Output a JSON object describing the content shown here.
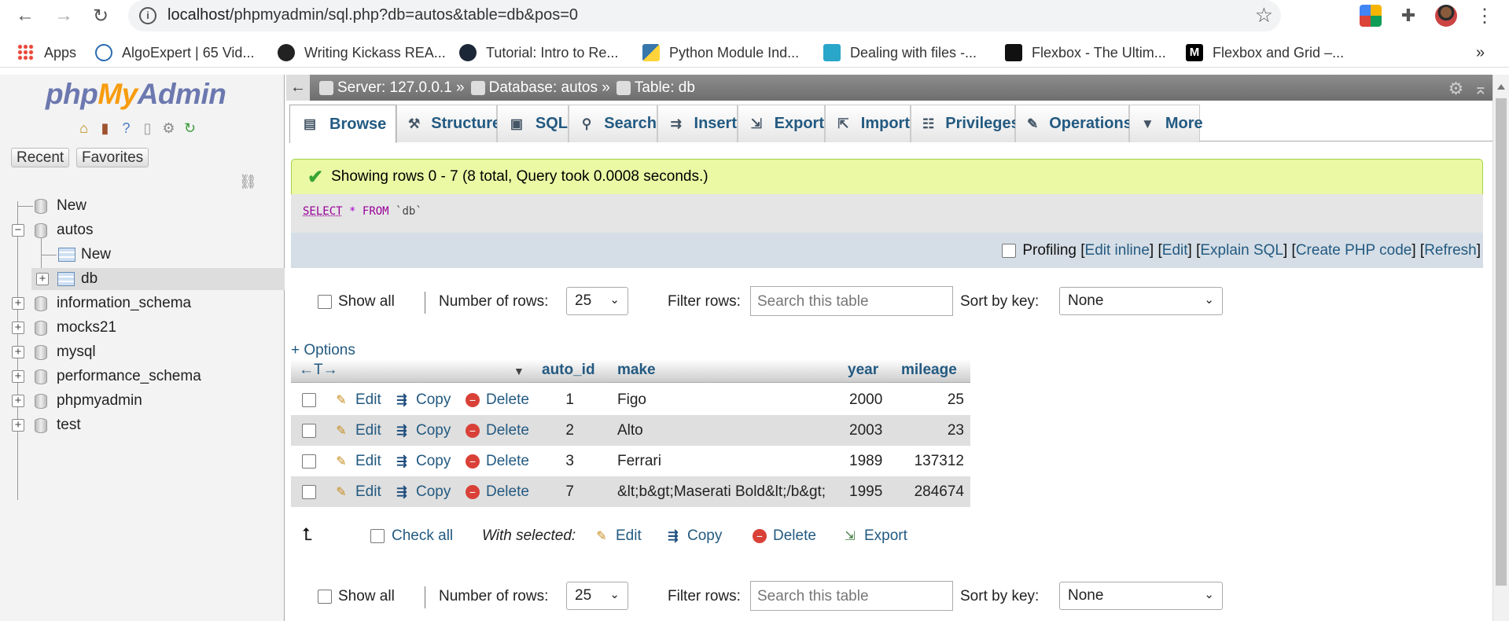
{
  "browser": {
    "url_host": "localhost",
    "url_path": "/phpmyadmin/sql.php?db=autos&table=db&pos=0",
    "bookmarks": [
      {
        "label": "Apps",
        "icon": "apps-grid-icon",
        "color": "#ea4335"
      },
      {
        "label": "AlgoExpert | 65 Vid...",
        "icon": "algoexpert-icon",
        "color": "#2b6cb0"
      },
      {
        "label": "Writing Kickass REA...",
        "icon": "github-icon",
        "color": "#222222"
      },
      {
        "label": "Tutorial: Intro to Re...",
        "icon": "react-icon",
        "color": "#1b2636"
      },
      {
        "label": "Python Module Ind...",
        "icon": "python-icon",
        "color": "#3776ab"
      },
      {
        "label": "Dealing with files -...",
        "icon": "bookmark-site-icon",
        "color": "#2aa6c9"
      },
      {
        "label": "Flexbox - The Ultim...",
        "icon": "flexbox-icon",
        "color": "#111111"
      },
      {
        "label": "Flexbox and Grid –...",
        "icon": "medium-icon",
        "color": "#000000"
      }
    ],
    "overflow": "»"
  },
  "sidebar": {
    "logo": {
      "php": "php",
      "my": "My",
      "admin": "Admin"
    },
    "tabs": [
      "Recent",
      "Favorites"
    ],
    "tree": [
      {
        "label": "New",
        "type": "new-db"
      },
      {
        "label": "autos",
        "type": "db-expanded"
      },
      {
        "label": "New",
        "type": "new-table"
      },
      {
        "label": "db",
        "type": "table-selected"
      },
      {
        "label": "information_schema",
        "type": "db"
      },
      {
        "label": "mocks21",
        "type": "db"
      },
      {
        "label": "mysql",
        "type": "db"
      },
      {
        "label": "performance_schema",
        "type": "db"
      },
      {
        "label": "phpmyadmin",
        "type": "db"
      },
      {
        "label": "test",
        "type": "db"
      }
    ]
  },
  "breadcrumb": {
    "server": "Server: 127.0.0.1 »",
    "database": "Database: autos »",
    "table": "Table: db"
  },
  "tabs": [
    {
      "label": "Browse",
      "icon": "browse-icon",
      "active": true
    },
    {
      "label": "Structure",
      "icon": "structure-icon"
    },
    {
      "label": "SQL",
      "icon": "sql-icon"
    },
    {
      "label": "Search",
      "icon": "search-icon"
    },
    {
      "label": "Insert",
      "icon": "insert-icon"
    },
    {
      "label": "Export",
      "icon": "export-icon"
    },
    {
      "label": "Import",
      "icon": "import-icon"
    },
    {
      "label": "Privileges",
      "icon": "privileges-icon"
    },
    {
      "label": "Operations",
      "icon": "operations-icon"
    },
    {
      "label": "More",
      "icon": "more-dropdown-icon"
    }
  ],
  "result": {
    "message": "Showing rows 0 - 7 (8 total, Query took 0.0008 seconds.)",
    "sql_select": "SELECT",
    "sql_star": "*",
    "sql_from": "FROM",
    "sql_table": "`db`",
    "profiling": "Profiling",
    "links": {
      "edit_inline": "Edit inline",
      "edit": "Edit",
      "explain": "Explain SQL",
      "php": "Create PHP code",
      "refresh": "Refresh"
    }
  },
  "controls": {
    "show_all": "Show all",
    "num_rows_label": "Number of rows:",
    "num_rows_value": "25",
    "filter_label": "Filter rows:",
    "filter_placeholder": "Search this table",
    "sort_label": "Sort by key:",
    "sort_value": "None"
  },
  "options_link": "+ Options",
  "table": {
    "arrows": "←T→",
    "columns": [
      "auto_id",
      "make",
      "year",
      "mileage"
    ],
    "action_labels": {
      "edit": "Edit",
      "copy": "Copy",
      "delete": "Delete"
    },
    "rows": [
      {
        "auto_id": "1",
        "make": "Figo",
        "year": "2000",
        "mileage": "25"
      },
      {
        "auto_id": "2",
        "make": "Alto",
        "year": "2003",
        "mileage": "23"
      },
      {
        "auto_id": "3",
        "make": "Ferrari",
        "year": "1989",
        "mileage": "137312"
      },
      {
        "auto_id": "7",
        "make": "&lt;b&gt;Maserati Bold&lt;/b&gt;",
        "year": "1995",
        "mileage": "284674"
      }
    ]
  },
  "with_selected": {
    "check_all": "Check all",
    "label": "With selected:",
    "edit": "Edit",
    "copy": "Copy",
    "delete": "Delete",
    "export": "Export"
  }
}
